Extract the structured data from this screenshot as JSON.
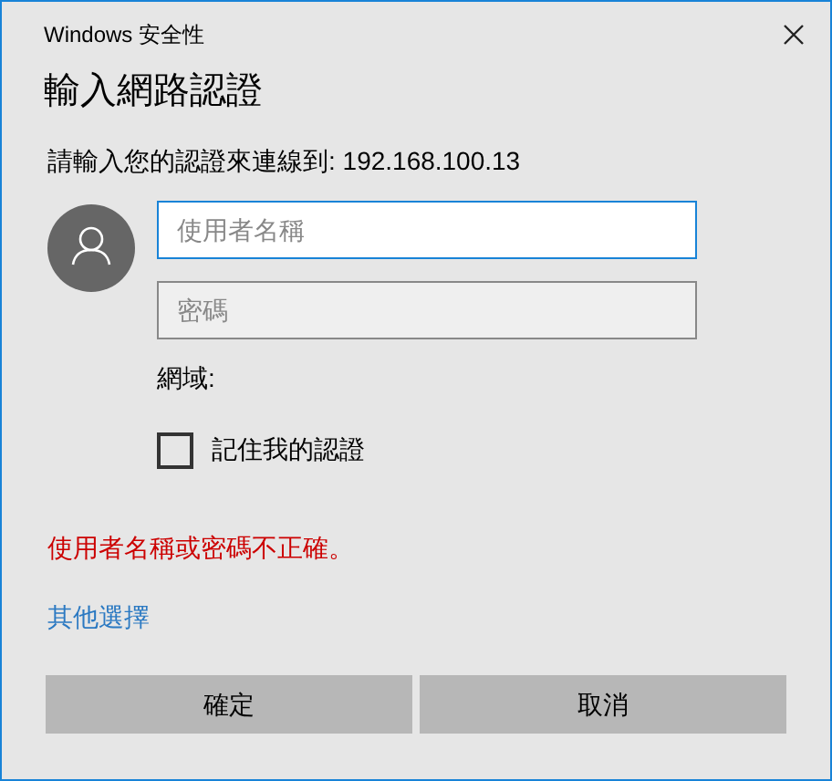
{
  "window": {
    "title": "Windows 安全性"
  },
  "heading": "輸入網路認證",
  "prompt": "請輸入您的認證來連線到: 192.168.100.13",
  "fields": [
    {
      "placeholder": "使用者名稱",
      "focused": true
    },
    {
      "placeholder": "密碼",
      "focused": false
    }
  ],
  "domain_label": "網域:",
  "remember": {
    "label": "記住我的認證",
    "checked": false
  },
  "error": "使用者名稱或密碼不正確。",
  "more_choices": "其他選擇",
  "buttons": [
    "確定",
    "取消"
  ]
}
